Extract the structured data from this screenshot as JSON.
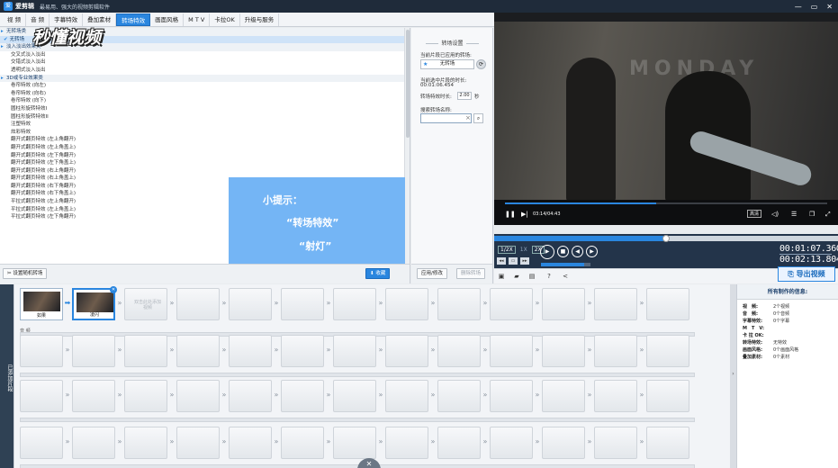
{
  "titlebar": {
    "logo": "爱",
    "app_name": "爱剪辑",
    "slogan": "最易用、强大的视频剪辑软件",
    "min_glyph": "—",
    "max_glyph": "▭",
    "close_glyph": "✕"
  },
  "menu": {
    "tabs": [
      "视 频",
      "音 频",
      "字幕特效",
      "叠加素材",
      "转场特效",
      "画面风格",
      "M T V",
      "卡拉OK",
      "升级与服务"
    ],
    "active_index": 4
  },
  "watermark": "秒懂视频",
  "effects_list": {
    "rows": [
      {
        "text": "无转场类",
        "kind": "group"
      },
      {
        "text": "无转场",
        "kind": "selected"
      },
      {
        "text": "淡入淡出效果类",
        "kind": "group"
      },
      {
        "text": "交叉式淡入淡出",
        "kind": "item"
      },
      {
        "text": "交错式淡入淡出",
        "kind": "item"
      },
      {
        "text": "透明式淡入淡出",
        "kind": "item"
      },
      {
        "text": "3D或专业效果类",
        "kind": "group"
      },
      {
        "text": "卷帘特效 (向左)",
        "kind": "item"
      },
      {
        "text": "卷帘特效 (向右)",
        "kind": "item"
      },
      {
        "text": "卷帘特效 (向下)",
        "kind": "item"
      },
      {
        "text": "圆柱形旋转特效I",
        "kind": "item"
      },
      {
        "text": "圆柱形旋转特效II",
        "kind": "item"
      },
      {
        "text": "注塑特效",
        "kind": "item"
      },
      {
        "text": "炫彩特效",
        "kind": "item"
      },
      {
        "text": "翻开式翻页特效 (左上角翻开)",
        "kind": "item"
      },
      {
        "text": "翻开式翻页特效 (左上角盖上)",
        "kind": "item"
      },
      {
        "text": "翻开式翻页特效 (左下角翻开)",
        "kind": "item"
      },
      {
        "text": "翻开式翻页特效 (左下角盖上)",
        "kind": "item"
      },
      {
        "text": "翻开式翻页特效 (右上角翻开)",
        "kind": "item"
      },
      {
        "text": "翻开式翻页特效 (右上角盖上)",
        "kind": "item"
      },
      {
        "text": "翻开式翻页特效 (右下角翻开)",
        "kind": "item"
      },
      {
        "text": "翻开式翻页特效 (右下角盖上)",
        "kind": "item"
      },
      {
        "text": "平拉式翻页特效 (左上角翻开)",
        "kind": "item"
      },
      {
        "text": "平拉式翻页特效 (左上角盖上)",
        "kind": "item"
      },
      {
        "text": "平拉式翻页特效 (左下角翻开)",
        "kind": "item"
      }
    ]
  },
  "hint": {
    "title": "小提示：",
    "line1": "“转场特效”",
    "line2": "“射灯”"
  },
  "effects_bottom": {
    "random_btn": "设置随机转场",
    "favorite_btn": "收藏"
  },
  "settings": {
    "heading": "转场设置",
    "current_label": "当前片段已应用的转场:",
    "current_value": "无转场",
    "selected_dur_label": "当前选中片段的时长:",
    "selected_dur_value": "00:01:06.454",
    "trans_dur_label": "转场特效时长:",
    "trans_dur_value": "2.00",
    "trans_dur_unit": "秒",
    "search_label": "搜索转场名称:",
    "search_value": "",
    "apply_btn": "应用/修改",
    "delete_btn": "删除转场"
  },
  "video": {
    "bg_text": "MONDAY",
    "time": "03:14/04:43",
    "quality": "高清",
    "progress": 0.47
  },
  "player": {
    "speed_labels": [
      "1/2X",
      "1X",
      "2X"
    ],
    "timeline_progress": 0.5,
    "volume": 0.88,
    "current_time": "00:01:07.360",
    "total_time": "00:02:13.804",
    "export_btn": "导出视频"
  },
  "timeline": {
    "vertical_tab": "已添加片段",
    "clips": [
      {
        "caption": "如果"
      },
      {
        "caption": "凌闪"
      }
    ],
    "add_slot_text": "双击此处添加视频",
    "audio_label": "音 频"
  },
  "info": {
    "title": "所有制作的信息:",
    "rows": [
      {
        "k": "视　频:",
        "v": "2个视频"
      },
      {
        "k": "音　频:",
        "v": "0个音频"
      },
      {
        "k": "字幕特效:",
        "v": "0个字幕"
      },
      {
        "k": "M　T　V:",
        "v": ""
      },
      {
        "k": "卡 拉 OK:",
        "v": ""
      },
      {
        "k": "转场特效:",
        "v": "无特效"
      },
      {
        "k": "画面风格:",
        "v": "0个画面风格"
      },
      {
        "k": "叠加素材:",
        "v": "0个素材"
      }
    ]
  },
  "colors": {
    "accent": "#2a86df",
    "titlebar": "#1f2b3a",
    "hint_bg": "#74b5f5"
  }
}
